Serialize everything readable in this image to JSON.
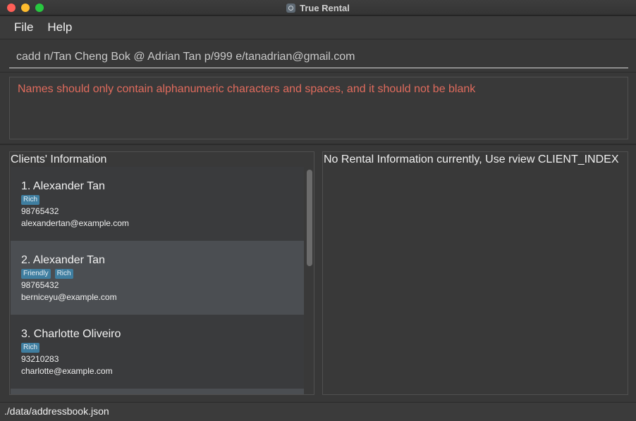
{
  "window": {
    "title": "True Rental"
  },
  "menu": [
    {
      "label": "File"
    },
    {
      "label": "Help"
    }
  ],
  "command": {
    "value": "cadd n/Tan Cheng Bok @ Adrian Tan p/999 e/tanadrian@gmail.com"
  },
  "result": {
    "message": "Names should only contain alphanumeric characters and spaces, and it should not be blank"
  },
  "clients": {
    "title": "Clients' Information",
    "items": [
      {
        "name": "1. Alexander Tan",
        "tags": [
          "Rich"
        ],
        "phone": "98765432",
        "email": "alexandertan@example.com"
      },
      {
        "name": "2. Alexander Tan",
        "tags": [
          "Friendly",
          "Rich"
        ],
        "phone": "98765432",
        "email": "berniceyu@example.com"
      },
      {
        "name": "3. Charlotte Oliveiro",
        "tags": [
          "Rich"
        ],
        "phone": "93210283",
        "email": "charlotte@example.com"
      }
    ]
  },
  "rental": {
    "message": "No Rental Information currently, Use rview CLIENT_INDEX"
  },
  "status": {
    "path": "./data/addressbook.json"
  },
  "colors": {
    "error": "#e06b5d",
    "tag": "#3f7ea0",
    "selected_card": "#4b4e52"
  }
}
